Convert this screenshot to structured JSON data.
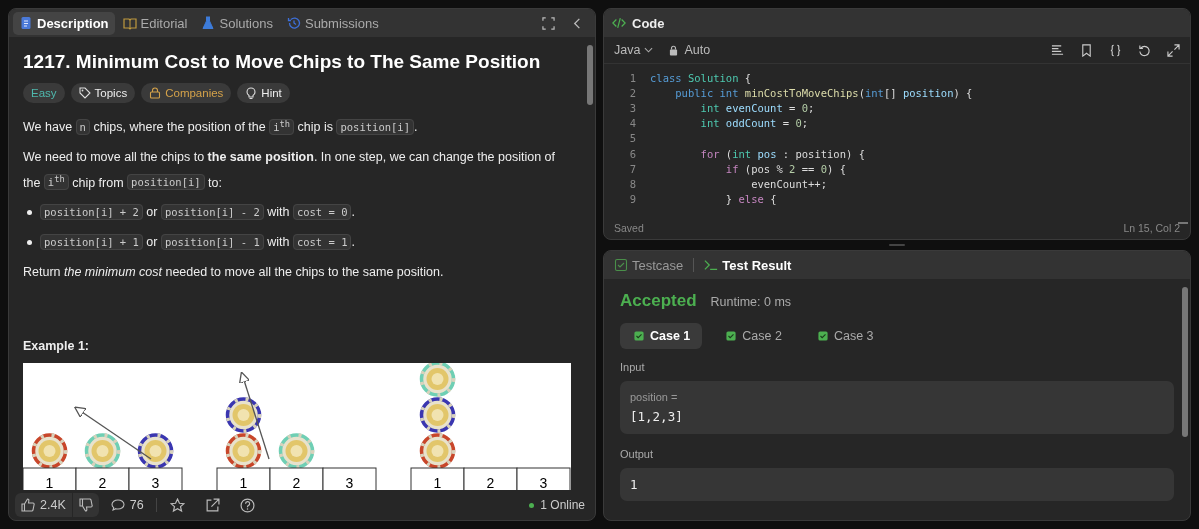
{
  "description_panel": {
    "tabs": [
      {
        "label": "Description",
        "selected": true
      },
      {
        "label": "Editorial",
        "selected": false
      },
      {
        "label": "Solutions",
        "selected": false
      },
      {
        "label": "Submissions",
        "selected": false
      }
    ],
    "title": "1217. Minimum Cost to Move Chips to The Same Position",
    "tags": [
      {
        "label": "Easy",
        "kind": "difficulty"
      },
      {
        "label": "Topics",
        "kind": "tag"
      },
      {
        "label": "Companies",
        "kind": "lock"
      },
      {
        "label": "Hint",
        "kind": "bulb"
      }
    ],
    "paragraphs": [
      {
        "kind": "text",
        "segments": [
          {
            "text": "We have "
          },
          {
            "code": "n"
          },
          {
            "text": " chips, where the position of the "
          },
          {
            "code": "i$^{th}$"
          },
          {
            "text": " chip is "
          },
          {
            "code": "position[i]"
          },
          {
            "text": "."
          }
        ]
      },
      {
        "kind": "text",
        "segments": [
          {
            "text": "We need to move all the chips to **the same position**. In one step, we can change the position of the "
          },
          {
            "code": "i$^{th}$"
          },
          {
            "text": " chip from "
          },
          {
            "code": "position[i]"
          },
          {
            "text": " to:"
          }
        ]
      },
      {
        "kind": "bullet",
        "segments": [
          {
            "code": "position[i] + 2"
          },
          {
            "text": " or "
          },
          {
            "code": "position[i] - 2"
          },
          {
            "text": " with "
          },
          {
            "code": "cost = 0"
          },
          {
            "text": "."
          }
        ]
      },
      {
        "kind": "bullet",
        "segments": [
          {
            "code": "position[i] + 1"
          },
          {
            "text": " or "
          },
          {
            "code": "position[i] - 1"
          },
          {
            "text": " with "
          },
          {
            "code": "cost = 1"
          },
          {
            "text": "."
          }
        ]
      },
      {
        "kind": "text",
        "segments": [
          {
            "text": "Return *the minimum cost* needed to move all the chips to the same position."
          }
        ]
      }
    ],
    "example_heading": "Example 1:",
    "figure": {
      "groups": [
        {
          "kind": "long-move",
          "cells": [
            {
              "label": "1",
              "chips": [
                {
                  "color": "#c8462a"
                }
              ]
            },
            {
              "label": "2",
              "chips": [
                {
                  "color": "#6fcfb4"
                }
              ]
            },
            {
              "label": "3",
              "chips": [
                {
                  "color": "#3a36b0"
                }
              ]
            }
          ]
        },
        {
          "kind": "short-move",
          "cells": [
            {
              "label": "1",
              "chips": [
                {
                  "color": "#c8462a"
                },
                {
                  "color": "#3a36b0"
                }
              ]
            },
            {
              "label": "2",
              "chips": [
                {
                  "color": "#6fcfb4"
                }
              ]
            },
            {
              "label": "3"
            }
          ]
        },
        {
          "kind": "final",
          "cells": [
            {
              "label": "1",
              "chips": [
                {
                  "color": "#c8462a"
                },
                {
                  "color": "#3a36b0"
                },
                {
                  "color": "#6fcfb4"
                }
              ]
            },
            {
              "label": "2"
            },
            {
              "label": "3"
            }
          ]
        }
      ]
    },
    "footer": {
      "likes": "2.4K",
      "comments": "76",
      "online": "1 Online"
    }
  },
  "code_panel": {
    "title": "Code",
    "language": "Java",
    "mode": "Auto",
    "lines": [
      {
        "number": "1",
        "tokens": [
          {
            "kind": "keyword",
            "text": "class "
          },
          {
            "kind": "type",
            "text": "Solution"
          },
          {
            "kind": "plain",
            "text": " {"
          }
        ]
      },
      {
        "number": "2",
        "tokens": [
          {
            "kind": "keyword",
            "text": "    public int "
          },
          {
            "kind": "func",
            "text": "minCostToMoveChips"
          },
          {
            "kind": "plain",
            "text": "("
          },
          {
            "kind": "keyword",
            "text": "int"
          },
          {
            "kind": "plain",
            "text": "[] "
          },
          {
            "kind": "var",
            "text": "position"
          },
          {
            "kind": "plain",
            "text": ") {"
          }
        ]
      },
      {
        "number": "3",
        "tokens": [
          {
            "kind": "type",
            "text": "        int "
          },
          {
            "kind": "var",
            "text": "evenCount"
          },
          {
            "kind": "plain",
            "text": " = "
          },
          {
            "kind": "number",
            "text": "0"
          },
          {
            "kind": "plain",
            "text": ";"
          }
        ]
      },
      {
        "number": "4",
        "tokens": [
          {
            "kind": "type",
            "text": "        int "
          },
          {
            "kind": "var",
            "text": "oddCount"
          },
          {
            "kind": "plain",
            "text": " = "
          },
          {
            "kind": "number",
            "text": "0"
          },
          {
            "kind": "plain",
            "text": ";"
          }
        ]
      },
      {
        "number": "5"
      },
      {
        "number": "6",
        "tokens": [
          {
            "kind": "control",
            "text": "        for"
          },
          {
            "kind": "plain",
            "text": " ("
          },
          {
            "kind": "type",
            "text": "int "
          },
          {
            "kind": "var",
            "text": "pos"
          },
          {
            "kind": "plain",
            "text": " : position) {"
          }
        ]
      },
      {
        "number": "7",
        "tokens": [
          {
            "kind": "control",
            "text": "            if"
          },
          {
            "kind": "plain",
            "text": " (pos % "
          },
          {
            "kind": "number",
            "text": "2"
          },
          {
            "kind": "plain",
            "text": " == "
          },
          {
            "kind": "number",
            "text": "0"
          },
          {
            "kind": "plain",
            "text": ") {"
          }
        ]
      },
      {
        "number": "8",
        "tokens": [
          {
            "kind": "plain",
            "text": "                evenCount++;"
          }
        ]
      },
      {
        "number": "9",
        "tokens": [
          {
            "kind": "plain",
            "text": "            } "
          },
          {
            "kind": "control",
            "text": "else"
          },
          {
            "kind": "plain",
            "text": " {"
          }
        ]
      }
    ],
    "status": "Saved",
    "cursor": "Ln 15, Col 2"
  },
  "result_panel": {
    "tabs": [
      {
        "label": "Testcase",
        "selected": false
      },
      {
        "label": "Test Result",
        "selected": true
      }
    ],
    "verdict": "Accepted",
    "runtime": "Runtime: 0 ms",
    "cases": [
      {
        "label": "Case 1",
        "selected": true
      },
      {
        "label": "Case 2",
        "selected": false
      },
      {
        "label": "Case 3",
        "selected": false
      }
    ],
    "input_label": "Input",
    "input_name": "position =",
    "input_value": "[1,2,3]",
    "output_label": "Output",
    "output_value": "1"
  }
}
